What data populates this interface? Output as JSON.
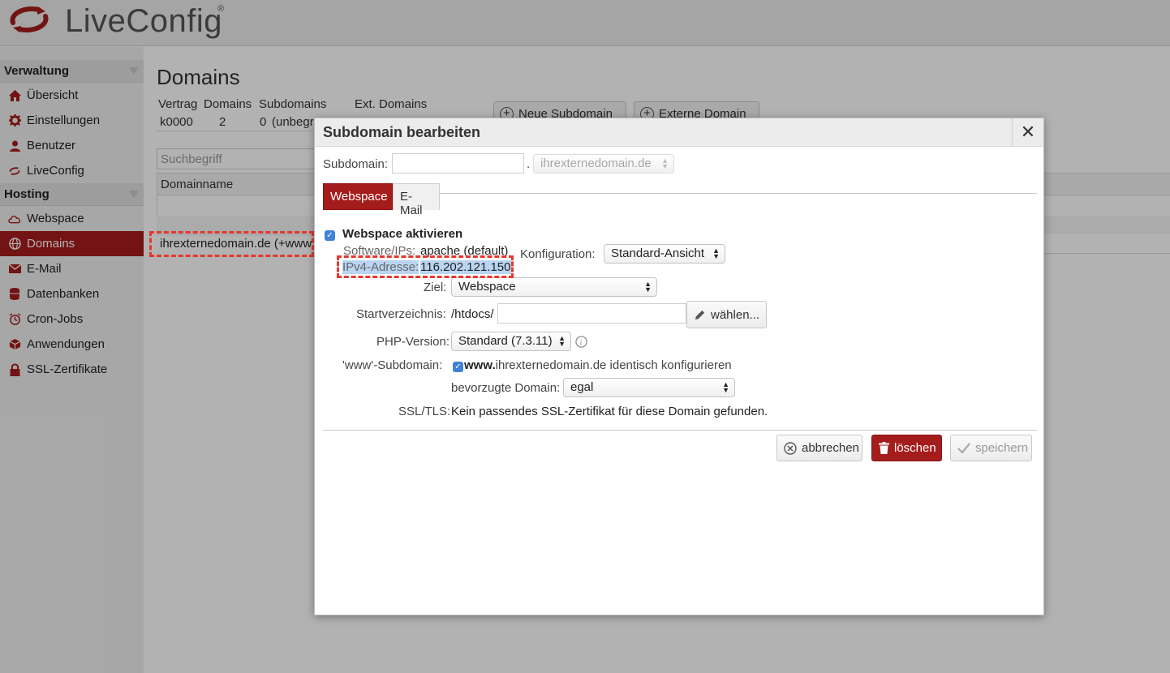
{
  "app": {
    "name": "LiveConfig",
    "reg": "®"
  },
  "sidebar": {
    "sections": [
      {
        "title": "Verwaltung",
        "items": [
          {
            "label": "Übersicht",
            "icon": "home-icon"
          },
          {
            "label": "Einstellungen",
            "icon": "gear-icon"
          },
          {
            "label": "Benutzer",
            "icon": "user-icon"
          },
          {
            "label": "LiveConfig",
            "icon": "liveconfig-icon"
          }
        ]
      },
      {
        "title": "Hosting",
        "items": [
          {
            "label": "Webspace",
            "icon": "cloud-icon"
          },
          {
            "label": "Domains",
            "icon": "globe-icon",
            "active": true
          },
          {
            "label": "E-Mail",
            "icon": "envelope-icon"
          },
          {
            "label": "Datenbanken",
            "icon": "database-icon"
          },
          {
            "label": "Cron-Jobs",
            "icon": "clock-icon"
          },
          {
            "label": "Anwendungen",
            "icon": "package-icon"
          },
          {
            "label": "SSL-Zertifikate",
            "icon": "lock-icon"
          }
        ]
      }
    ]
  },
  "main": {
    "title": "Domains",
    "info": {
      "headers": [
        "Vertrag",
        "Domains",
        "Subdomains",
        "Ext. Domains"
      ],
      "values": [
        "k0000",
        "2",
        "0",
        "(unbegr"
      ]
    },
    "buttons": {
      "new_subdomain": "Neue Subdomain",
      "external_domain": "Externe Domain"
    },
    "search_placeholder": "Suchbegriff",
    "list_header": "Domainname",
    "domain_row": "ihrexternedomain.de (+www.)"
  },
  "modal": {
    "title": "Subdomain bearbeiten",
    "close": "✕",
    "subdomain_label": "Subdomain:",
    "subdomain_value": "",
    "dot": ".",
    "domain_select": "ihrexternedomain.de",
    "tabs": [
      "Webspace",
      "E-Mail"
    ],
    "webspace_enable": "Webspace aktivieren",
    "software_label": "Software/IPs:",
    "software_value": "apache (default)",
    "ipv4_label": "IPv4-Adresse:",
    "ipv4_value": "116.202.121.150",
    "konfig_label": "Konfiguration:",
    "konfig_value": "Standard-Ansicht",
    "ziel_label": "Ziel:",
    "ziel_value": "Webspace",
    "start_label": "Startverzeichnis:",
    "start_prefix": "/htdocs/",
    "start_value": "",
    "choose_btn": "wählen...",
    "php_label": "PHP-Version:",
    "php_value": "Standard (7.3.11)",
    "www_label": "'www'-Subdomain:",
    "www_bold": "www.",
    "www_rest": "ihrexternedomain.de identisch konfigurieren",
    "pref_label": "bevorzugte Domain:",
    "pref_value": "egal",
    "ssl_label": "SSL/TLS:",
    "ssl_value": "Kein passendes SSL-Zertifikat für diese Domain gefunden.",
    "cancel": "abbrechen",
    "delete": "löschen",
    "save": "speichern"
  },
  "colors": {
    "accent": "#a51c1c",
    "highlight": "#e4382f",
    "checkbox": "#3f82d6"
  }
}
